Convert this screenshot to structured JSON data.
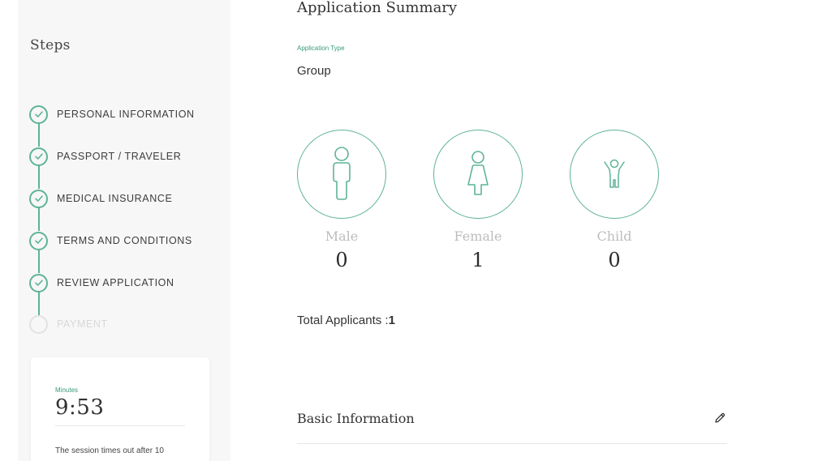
{
  "sidebar": {
    "title": "Steps",
    "steps": [
      {
        "label": "PERSONAL INFORMATION",
        "status": "complete"
      },
      {
        "label": "PASSPORT / TRAVELER",
        "status": "complete"
      },
      {
        "label": "MEDICAL INSURANCE",
        "status": "complete"
      },
      {
        "label": "TERMS AND CONDITIONS",
        "status": "complete"
      },
      {
        "label": "REVIEW APPLICATION",
        "status": "complete"
      },
      {
        "label": "PAYMENT",
        "status": "pending"
      }
    ],
    "timer": {
      "label": "Minutes",
      "value": "9:53",
      "note": "The session times out after 10"
    }
  },
  "main": {
    "title": "Application Summary",
    "application_type_label": "Application Type",
    "application_type_value": "Group",
    "applicants": [
      {
        "name": "Male",
        "count": "0",
        "icon": "male-icon"
      },
      {
        "name": "Female",
        "count": "1",
        "icon": "female-icon"
      },
      {
        "name": "Child",
        "count": "0",
        "icon": "child-icon"
      }
    ],
    "total_label": "Total Applicants :",
    "total_value": "1",
    "basic_info_title": "Basic Information"
  },
  "colors": {
    "accent": "#5fb397",
    "accent_text": "#3a9a78",
    "sidebar_bg": "#f7f7f7",
    "disabled": "#e2e2e2"
  }
}
